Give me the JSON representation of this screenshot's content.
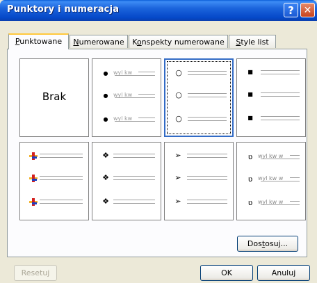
{
  "window": {
    "title": "Punktory i numeracja"
  },
  "tabs": [
    {
      "pre": "",
      "key": "P",
      "post": "unktowane"
    },
    {
      "pre": "",
      "key": "N",
      "post": "umerowane"
    },
    {
      "pre": "K",
      "key": "o",
      "post": "nspekty numerowane"
    },
    {
      "pre": "",
      "key": "S",
      "post": "tyle list"
    }
  ],
  "gallery": {
    "none_label": "Brak",
    "sample_text": "wyl kw",
    "sample_text_long": "wyl kw w",
    "bullets": {
      "filled_dot": "●",
      "hollow_circle": "○",
      "small_square": "■",
      "four_diamonds": "❖",
      "arrowhead": "➢",
      "ou_glyph": "ʋ",
      "picture_colors": [
        "#d4201e",
        "#1a3fc2",
        "#f2b22a"
      ]
    }
  },
  "buttons": {
    "customize": {
      "pre": "Dos",
      "key": "t",
      "post": "osuj..."
    },
    "reset": "Resetuj",
    "ok": "OK",
    "cancel": "Anuluj"
  }
}
